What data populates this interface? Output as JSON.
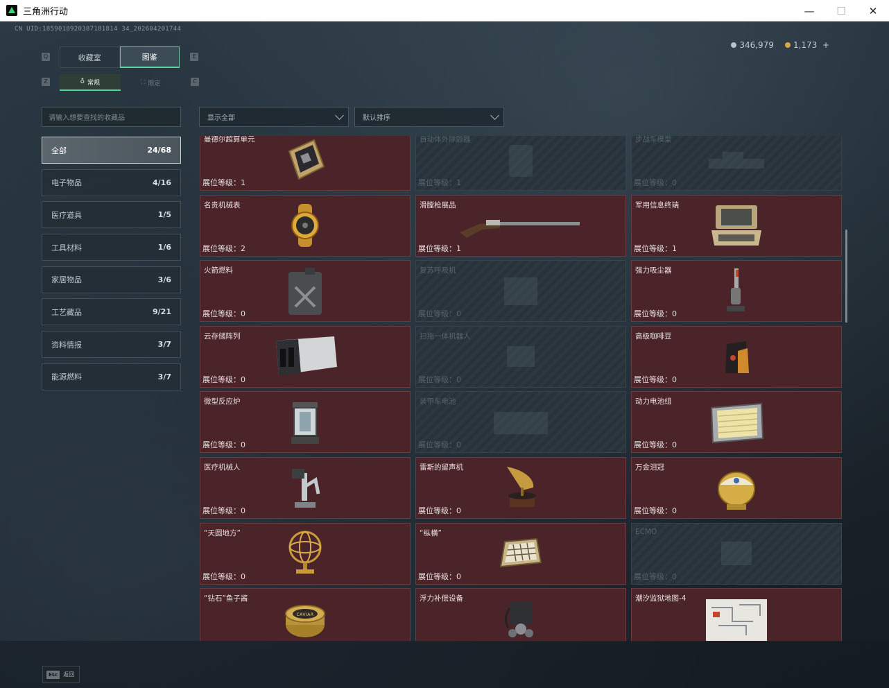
{
  "window": {
    "title": "三角洲行动",
    "minimize": "—",
    "maximize": "☐",
    "close": "✕"
  },
  "header": {
    "uid": "CN UID:1859018920387181814 34_202604201744",
    "silver": "346,979",
    "gold": "1,173",
    "add": "+"
  },
  "tabs": {
    "main": [
      "收藏室",
      "图鉴"
    ],
    "sub": [
      "常规",
      "限定"
    ],
    "active_main": 1,
    "active_sub": 0
  },
  "key_hints": {
    "q": "Q",
    "e": "E",
    "z": "Z",
    "c": "C"
  },
  "search": {
    "placeholder": "请输入想要查找的收藏品"
  },
  "filters": {
    "show": "显示全部",
    "sort": "默认排序"
  },
  "categories": [
    {
      "label": "全部",
      "count": "24/68"
    },
    {
      "label": "电子物品",
      "count": "4/16"
    },
    {
      "label": "医疗道具",
      "count": "1/5"
    },
    {
      "label": "工具材料",
      "count": "1/6"
    },
    {
      "label": "家居物品",
      "count": "3/6"
    },
    {
      "label": "工艺藏品",
      "count": "9/21"
    },
    {
      "label": "资料情报",
      "count": "3/7"
    },
    {
      "label": "能源燃料",
      "count": "3/7"
    }
  ],
  "level_prefix": "展位等级：",
  "items": [
    {
      "name": "曼德尔超算单元",
      "level": "1",
      "locked": false,
      "art": "chip"
    },
    {
      "name": "自动体外除颤器",
      "level": "1",
      "locked": true,
      "art": "aed"
    },
    {
      "name": "步战车模型",
      "level": "0",
      "locked": true,
      "art": "tank"
    },
    {
      "name": "名贵机械表",
      "level": "2",
      "locked": false,
      "art": "watch"
    },
    {
      "name": "滑膛枪展品",
      "level": "1",
      "locked": false,
      "art": "musket"
    },
    {
      "name": "军用信息终端",
      "level": "1",
      "locked": false,
      "art": "terminal"
    },
    {
      "name": "火箭燃料",
      "level": "0",
      "locked": false,
      "art": "jerrycan"
    },
    {
      "name": "复苏呼吸机",
      "level": "0",
      "locked": true,
      "art": "ventilator"
    },
    {
      "name": "强力吸尘器",
      "level": "0",
      "locked": false,
      "art": "vacuum"
    },
    {
      "name": "云存储阵列",
      "level": "0",
      "locked": false,
      "art": "server"
    },
    {
      "name": "扫拖一体机器人",
      "level": "0",
      "locked": true,
      "art": "robot"
    },
    {
      "name": "高级咖啡豆",
      "level": "0",
      "locked": false,
      "art": "coffee"
    },
    {
      "name": "微型反应炉",
      "level": "0",
      "locked": false,
      "art": "reactor"
    },
    {
      "name": "装甲车电池",
      "level": "0",
      "locked": true,
      "art": "battery-dim"
    },
    {
      "name": "动力电池组",
      "level": "0",
      "locked": false,
      "art": "battery"
    },
    {
      "name": "医疗机械人",
      "level": "0",
      "locked": false,
      "art": "medbot"
    },
    {
      "name": "雷斯的留声机",
      "level": "0",
      "locked": false,
      "art": "gramophone"
    },
    {
      "name": "万金泪冠",
      "level": "0",
      "locked": false,
      "art": "egg"
    },
    {
      "name": "“天圆地方”",
      "level": "0",
      "locked": false,
      "art": "globe"
    },
    {
      "name": "“纵横”",
      "level": "0",
      "locked": false,
      "art": "chess"
    },
    {
      "name": "ECMO",
      "level": "0",
      "locked": true,
      "art": "ecmo"
    },
    {
      "name": "“钻石”鱼子酱",
      "level": "",
      "locked": false,
      "art": "caviar"
    },
    {
      "name": "浮力补偿设备",
      "level": "",
      "locked": false,
      "art": "bcd"
    },
    {
      "name": "潮汐监狱地图-4",
      "level": "",
      "locked": false,
      "art": "map"
    }
  ],
  "caviar_label": "CAVIAR",
  "bottom": {
    "esc": "Esc",
    "back": "返回"
  }
}
